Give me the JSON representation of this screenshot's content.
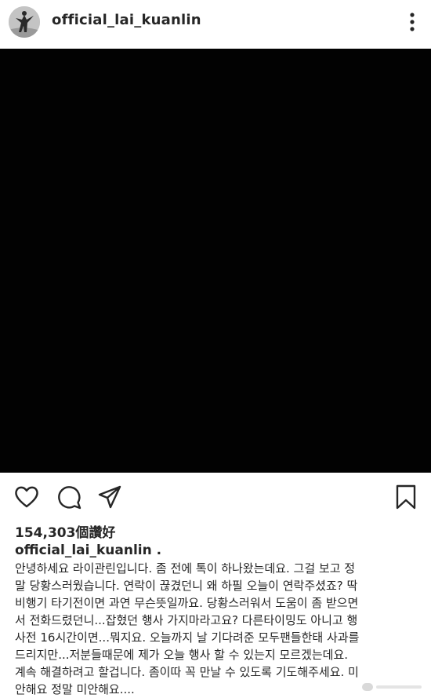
{
  "post": {
    "username": "official_lai_kuanlin",
    "likes_label": "154,303個讚好",
    "caption_username": "official_lai_kuanlin .",
    "caption_lines": [
      "안녕하세요 라이관린입니다. 좀 전에 톡이 하나왔는데요. 그걸 보고 정",
      "말 당황스러웠습니다. 연락이 끊겼던니 왜 하필 오늘이 연락주셨죠? 딱",
      "비행기 타기전이면 과연 무슨뜻일까요. 당황스러워서 도움이 좀 받으면",
      "서 전화드렸던니...잡혔던 행사 가지마라고요? 다른타이밍도 아니고 행",
      "사전 16시간이면...뭐지요. 오늘까지 날 기다려준 모두팬들한태 사과를",
      "드리지만...저분들때문에 제가 오늘 행사 할 수 있는지 모르겠는데요.",
      "계속 해결하려고 할겁니다. 좀이따 꼭 만날 수 있도록 기도해주세요. 미",
      "안해요 정말 미안해요...."
    ]
  },
  "icons": {
    "more": "more-options-icon",
    "like": "heart-icon",
    "comment": "comment-icon",
    "share": "share-icon",
    "save": "bookmark-icon"
  },
  "colors": {
    "text": "#262626",
    "photo_background": "#020202"
  }
}
